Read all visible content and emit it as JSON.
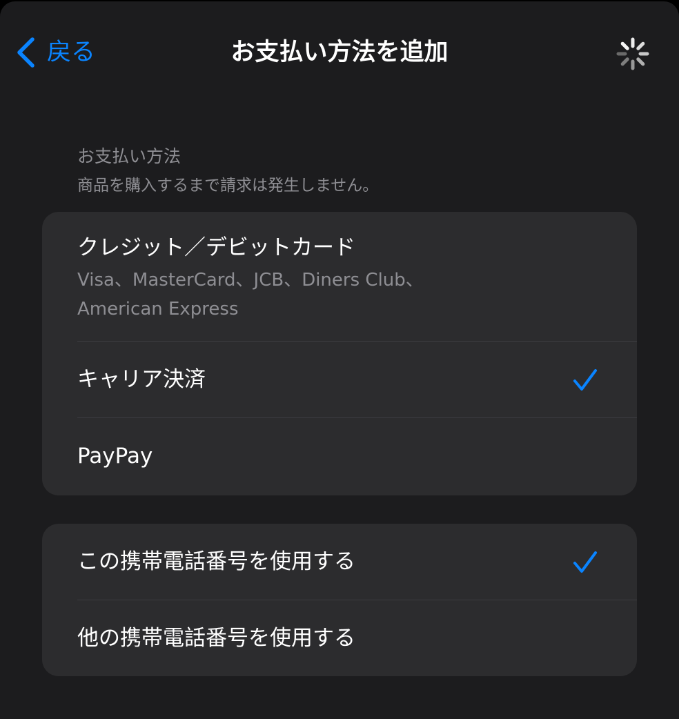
{
  "nav": {
    "back_label": "戻る",
    "title": "お支払い方法を追加",
    "loading_icon": "spinner-icon"
  },
  "section": {
    "title": "お支払い方法",
    "subtitle": "商品を購入するまで請求は発生しません。"
  },
  "payment_methods": [
    {
      "label": "クレジット／デビットカード",
      "detail_line1": "Visa、MasterCard、JCB、Diners Club、",
      "detail_line2": "American Express",
      "selected": false
    },
    {
      "label": "キャリア決済",
      "selected": true
    },
    {
      "label": "PayPay",
      "selected": false
    }
  ],
  "phone_options": [
    {
      "label": "この携帯電話番号を使用する",
      "selected": true
    },
    {
      "label": "他の携帯電話番号を使用する",
      "selected": false
    }
  ],
  "colors": {
    "accent": "#0a84ff",
    "background": "#1c1c1e",
    "group_background": "#2c2c2e",
    "secondary_text": "#8e8e93"
  }
}
